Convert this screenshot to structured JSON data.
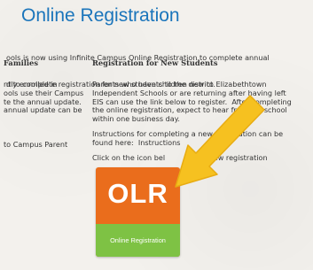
{
  "page": {
    "title": "Online Registration",
    "intro_lines": [
      "ools is now using Infinite Campus Online Registration to complete annual",
      "d to complete registration for new students to the district."
    ]
  },
  "left_column": {
    "heading": "Families",
    "lines": [
      "ntly enrolled in",
      "ools use their Campus",
      "te the annual update.",
      "annual update can be",
      "to Campus Parent"
    ]
  },
  "right_column": {
    "heading": "Registration for New Students",
    "paragraph_lines": [
      "Parents who have children new to Elizabethtown",
      "Independent Schools or are returning after having left",
      "EIS can use the link below to register.  After completing",
      "the online registration, expect to hear from the school",
      "within one business day."
    ],
    "instructions_lines": [
      "Instructions for completing a new registration can be",
      "found here:"
    ],
    "instructions_link": "Instructions",
    "click_prefix": "Click on the icon bel",
    "click_suffix": "a new registration"
  },
  "olr_button": {
    "label": "OLR",
    "caption": "Online Registration",
    "colors": {
      "top": "#ea6d1c",
      "bottom": "#7ec244"
    }
  },
  "annotation": {
    "icon": "pointer-arrow-icon",
    "color": "#f6c120"
  },
  "colors": {
    "title": "#1b75bb",
    "text": "#333333",
    "background": "#f3f1ed"
  }
}
